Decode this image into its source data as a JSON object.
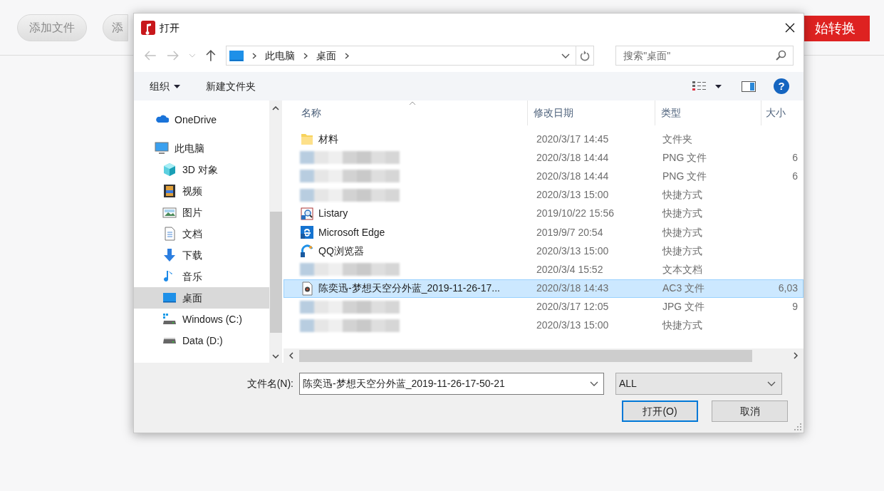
{
  "app": {
    "buttons": [
      {
        "label": "添加文件",
        "kind": "pill"
      },
      {
        "label": "添",
        "kind": "pill-cut"
      },
      {
        "label": "始转换",
        "kind": "primary"
      }
    ]
  },
  "dialog": {
    "title": "打开",
    "address": {
      "path": [
        "此电脑",
        "桌面"
      ]
    },
    "search": {
      "placeholder": "搜索\"桌面\""
    },
    "toolbar": {
      "organize": "组织",
      "new_folder": "新建文件夹",
      "help": "?"
    },
    "nav": [
      {
        "label": "OneDrive",
        "selected": false
      },
      {
        "label": "此电脑",
        "selected": false,
        "children": [
          {
            "label": "3D 对象",
            "selected": false
          },
          {
            "label": "视频",
            "selected": false
          },
          {
            "label": "图片",
            "selected": false
          },
          {
            "label": "文档",
            "selected": false
          },
          {
            "label": "下载",
            "selected": false
          },
          {
            "label": "音乐",
            "selected": false
          },
          {
            "label": "桌面",
            "selected": true
          },
          {
            "label": "Windows (C:)",
            "selected": false
          },
          {
            "label": "Data (D:)",
            "selected": false
          }
        ]
      }
    ],
    "columns": [
      "名称",
      "修改日期",
      "类型",
      "大小"
    ],
    "rows": [
      {
        "kind": "folder",
        "name": "材料",
        "date": "2020/3/17 14:45",
        "type": "文件夹",
        "selected": false
      },
      {
        "kind": "blurred",
        "date": "2020/3/18 14:44",
        "type": "PNG 文件",
        "size": "6",
        "selected": false
      },
      {
        "kind": "blurred",
        "date": "2020/3/18 14:44",
        "type": "PNG 文件",
        "size": "6",
        "selected": false
      },
      {
        "kind": "blurred",
        "date": "2020/3/13 15:00",
        "type": "快捷方式",
        "selected": false
      },
      {
        "kind": "shortcut",
        "name": "Listary",
        "date": "2019/10/22 15:56",
        "type": "快捷方式",
        "selected": false
      },
      {
        "kind": "browser",
        "name": "Microsoft Edge",
        "date": "2019/9/7 20:54",
        "type": "快捷方式",
        "selected": false
      },
      {
        "kind": "app",
        "name": "QQ浏览器",
        "date": "2020/3/13 15:00",
        "type": "快捷方式",
        "selected": false
      },
      {
        "kind": "blurred",
        "date": "2020/3/4 15:52",
        "type": "文本文档",
        "selected": false
      },
      {
        "kind": "audio",
        "name": "陈奕迅-梦想天空分外蓝_2019-11-26-17...",
        "date": "2020/3/18 14:43",
        "type": "AC3 文件",
        "size": "6,03",
        "selected": true
      },
      {
        "kind": "blurred",
        "date": "2020/3/17 12:05",
        "type": "JPG 文件",
        "size": "9",
        "selected": false
      },
      {
        "kind": "blurred",
        "date": "2020/3/13 15:00",
        "type": "快捷方式",
        "selected": false
      }
    ],
    "filename": {
      "label": "文件名(N):",
      "value": "陈奕迅-梦想天空分外蓝_2019-11-26-17-50-21"
    },
    "filter": {
      "value": "ALL"
    },
    "buttons": [
      {
        "label": "打开(O)",
        "kind": "default"
      },
      {
        "label": "取消",
        "kind": "normal"
      }
    ]
  }
}
